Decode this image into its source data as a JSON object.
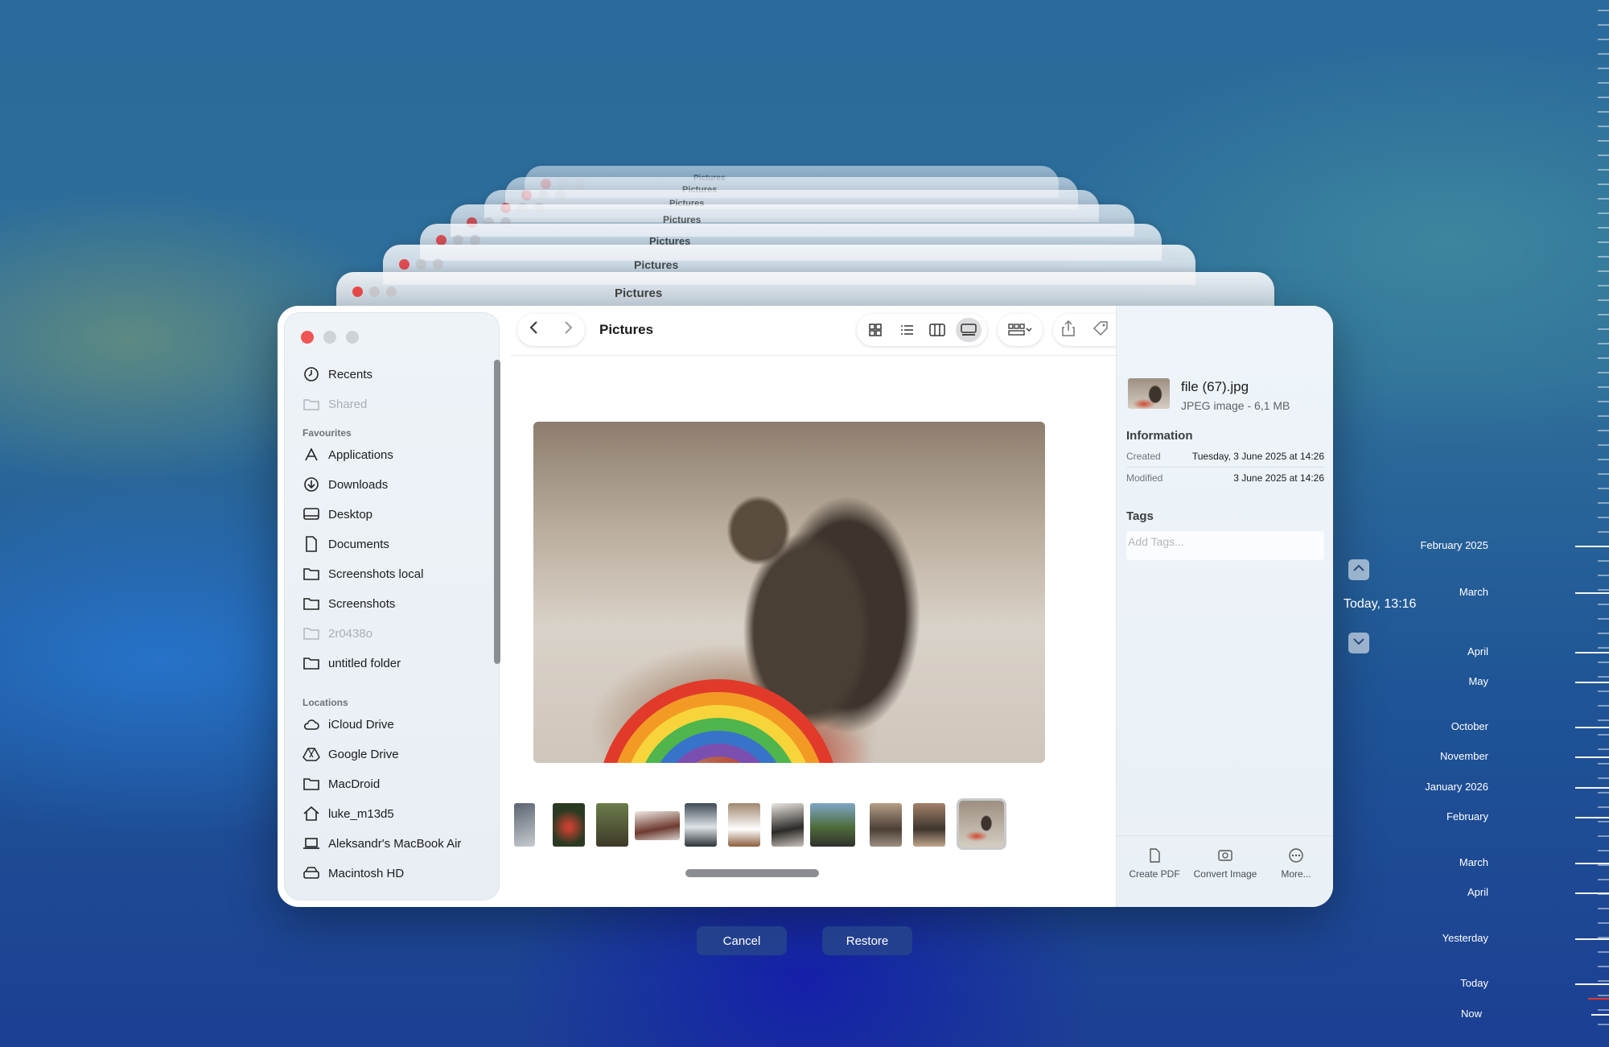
{
  "window": {
    "title": "Pictures"
  },
  "sidebar": {
    "top_items": [
      {
        "label": "Recents",
        "icon": "clock-icon",
        "dim": false
      },
      {
        "label": "Shared",
        "icon": "shared-folder-icon",
        "dim": true
      }
    ],
    "favourites_header": "Favourites",
    "favourites": [
      {
        "label": "Applications",
        "icon": "applications-icon"
      },
      {
        "label": "Downloads",
        "icon": "download-icon"
      },
      {
        "label": "Desktop",
        "icon": "desktop-icon"
      },
      {
        "label": "Documents",
        "icon": "document-icon"
      },
      {
        "label": "Screenshots local",
        "icon": "folder-icon"
      },
      {
        "label": "Screenshots",
        "icon": "folder-icon"
      },
      {
        "label": "2r0438o",
        "icon": "folder-icon",
        "dim": true
      },
      {
        "label": "untitled folder",
        "icon": "folder-icon"
      }
    ],
    "locations_header": "Locations",
    "locations": [
      {
        "label": "iCloud Drive",
        "icon": "cloud-icon"
      },
      {
        "label": "Google Drive",
        "icon": "google-drive-icon"
      },
      {
        "label": "MacDroid",
        "icon": "folder-icon"
      },
      {
        "label": "luke_m13d5",
        "icon": "home-icon"
      },
      {
        "label": "Aleksandr's MacBook Air",
        "icon": "laptop-icon"
      },
      {
        "label": "Macintosh HD",
        "icon": "disk-icon"
      }
    ]
  },
  "inspector": {
    "file_name": "file (67).jpg",
    "file_meta": "JPEG image - 6,1 MB",
    "information_header": "Information",
    "created_label": "Created",
    "created_value": "Tuesday, 3 June 2025 at 14:26",
    "modified_label": "Modified",
    "modified_value": "3 June 2025 at 14:26",
    "tags_header": "Tags",
    "tags_placeholder": "Add Tags...",
    "actions": [
      {
        "label": "Create PDF",
        "icon": "pdf-icon"
      },
      {
        "label": "Convert Image",
        "icon": "convert-image-icon"
      },
      {
        "label": "More...",
        "icon": "more-icon"
      }
    ]
  },
  "buttons": {
    "cancel": "Cancel",
    "restore": "Restore"
  },
  "timeline": {
    "current": "Today, 13:16",
    "labels": [
      "February 2025",
      "March",
      "April",
      "May",
      "October",
      "November",
      "January 2026",
      "February",
      "March",
      "April",
      "Yesterday",
      "Today",
      "Now"
    ]
  },
  "colors": {
    "close_button": "#f05454",
    "accent_bar": "#e23a2a"
  }
}
